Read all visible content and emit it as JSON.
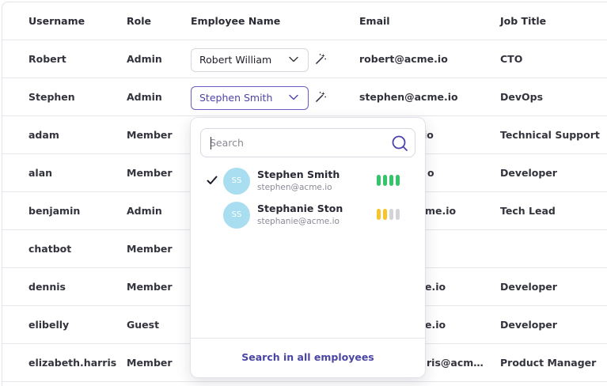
{
  "table": {
    "headers": {
      "username": "Username",
      "role": "Role",
      "employee_name": "Employee Name",
      "email": "Email",
      "job_title": "Job Title"
    },
    "rows": [
      {
        "username": "Robert",
        "role": "Admin",
        "employee": "Robert William",
        "email": "robert@acme.io",
        "job": "CTO"
      },
      {
        "username": "Stephen",
        "role": "Admin",
        "employee": "Stephen Smith",
        "email": "stephen@acme.io",
        "job": "DevOps"
      },
      {
        "username": "adam",
        "role": "Member",
        "email": "io",
        "job": "Technical Support"
      },
      {
        "username": "alan",
        "role": "Member",
        "email": "o",
        "job": "Developer"
      },
      {
        "username": "benjamin",
        "role": "Admin",
        "email": "me.io",
        "job": "Tech Lead"
      },
      {
        "username": "chatbot",
        "role": "Member",
        "email": "",
        "job": ""
      },
      {
        "username": "dennis",
        "role": "Member",
        "email": "e.io",
        "job": "Developer"
      },
      {
        "username": "elibelly",
        "role": "Guest",
        "email": "e.io",
        "job": "Developer"
      },
      {
        "username": "elizabeth.harris",
        "role": "Member",
        "email": "ris@acm…",
        "job": "Product Manager"
      }
    ]
  },
  "dropdown": {
    "search_placeholder": "Search",
    "options": [
      {
        "initials": "SS",
        "name": "Stephen Smith",
        "email": "stephen@acme.io",
        "selected": true,
        "strength": 4,
        "strength_color": "#34c46a"
      },
      {
        "initials": "SS",
        "name": "Stephanie Ston",
        "email": "stephanie@acme.io",
        "selected": false,
        "strength": 2,
        "strength_color": "#f5c52b"
      }
    ],
    "footer_link": "Search in all employees"
  },
  "colors": {
    "accent": "#4d43a8",
    "avatar_bg": "#a8def0",
    "bar_empty": "#d3d3d8"
  },
  "icons": {
    "chevron": "chevron-down-icon",
    "wand": "magic-wand-icon",
    "search": "search-icon",
    "check": "check-icon"
  }
}
